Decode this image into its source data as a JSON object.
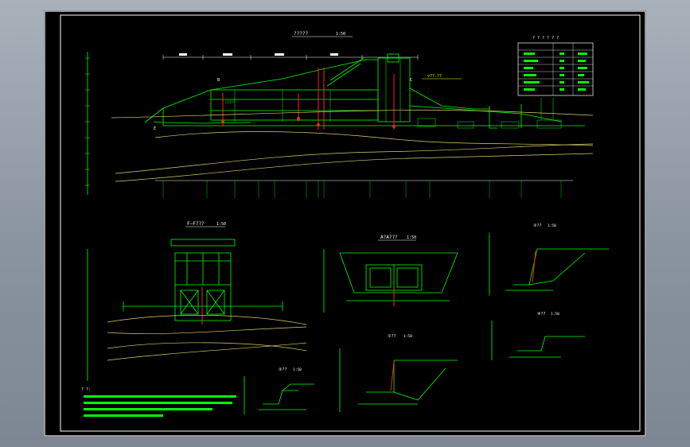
{
  "drawing": {
    "main_title": "?????",
    "section_b_title": "F—F???",
    "section_c_title": "A?A???",
    "detail1_title": "①??",
    "detail2_title": "②??",
    "detail3_title": "③??",
    "detail4_title": "④??",
    "scale_label": "1:50",
    "table_header": "? ? ? ? ? ?",
    "notes_head": "? ?:",
    "marker_b": "B",
    "marker_c": "C",
    "marker_e": "E",
    "elevation_callout": "▽??.??",
    "material_callout": "C15??"
  },
  "colors": {
    "background": "#000000",
    "frame": "#ffffff",
    "line": "#00ff00",
    "terrain": "#d9d06a",
    "dimension": "#ffffff",
    "accent": "#ff2020",
    "callout": "#ffff00"
  }
}
